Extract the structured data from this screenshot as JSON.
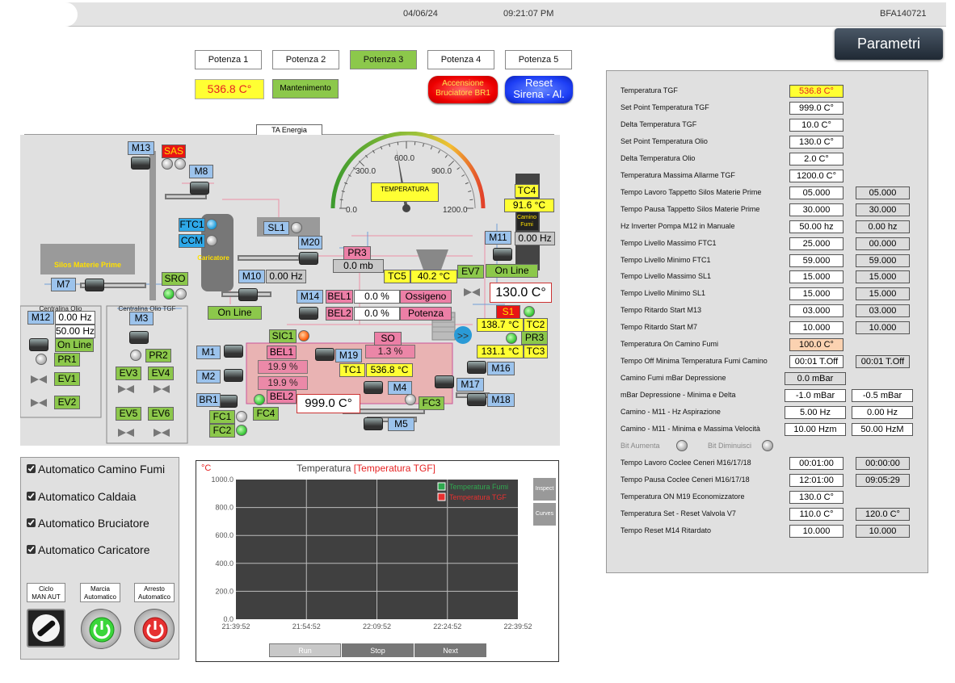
{
  "header": {
    "date": "04/06/24",
    "time": "09:21:07 PM",
    "device": "BFA140721"
  },
  "parametri_label": "Parametri",
  "potenza": [
    "Potenza 1",
    "Potenza 2",
    "Potenza 3",
    "Potenza 4",
    "Potenza 5"
  ],
  "potenza_active": 2,
  "temp_main": "536.8 C°",
  "mantenimento": "Mantenimento",
  "accensione": {
    "line1": "Accensione",
    "line2": "Bruciatore BR1"
  },
  "reset": {
    "line1": "Reset",
    "line2": "Sirena - Al."
  },
  "plant": {
    "ta_energia": "TA Energia",
    "gauge": {
      "t0": "0.0",
      "t300": "300.0",
      "t600": "600.0",
      "t900": "900.0",
      "t1200": "1200.0",
      "label": "TEMPERATURA",
      "value_fraction": 0.447
    },
    "silos": "Silos Materie Prime",
    "caricatore": "Caricatore",
    "camino": {
      "line1": "Camino",
      "line2": "Fumi"
    },
    "centralina_olio": "Centralina Olio",
    "centralina_olio_tgf": "Centralina Olio TGF",
    "labels": {
      "m13": "M13",
      "sas": "SAS",
      "m8": "M8",
      "ftc1": "FTC1",
      "ccm": "CCM",
      "sl1": "SL1",
      "m20": "M20",
      "pr3": "PR3",
      "pr3_val": "0.0 mb",
      "tc4": "TC4",
      "tc4_val": "91.6 °C",
      "m11": "M11",
      "m11_val": "0.00 Hz",
      "on_line_a": "On Line",
      "ev7": "EV7",
      "tc5": "TC5",
      "tc5_val": "40.2 °C",
      "m7": "M7",
      "sro": "SRO",
      "m10": "M10",
      "m10_val": "0.00 Hz",
      "on_line_b": "On Line",
      "m14": "M14",
      "bel1": "BEL1",
      "bel1_val": "0.0 %",
      "ossigeno": "Ossigeno",
      "bel2": "BEL2",
      "bel2_val": "0.0 %",
      "potenza": "Potenza",
      "big_temp": "130.0 C°",
      "s1": "S1",
      "tc2_val": "138.7 °C",
      "tc2": "TC2",
      "pr3b": "PR3",
      "tc3_val": "131.1 °C",
      "tc3": "TC3",
      "m12": "M12",
      "m12_val": "0.00 Hz",
      "m12_set": "50.00 Hz",
      "on_line_c": "On Line",
      "pr1": "PR1",
      "m3": "M3",
      "pr2": "PR2",
      "ev1": "EV1",
      "ev3": "EV3",
      "ev4": "EV4",
      "ev2": "EV2",
      "ev5": "EV5",
      "ev6": "EV6",
      "sic1": "SIC1",
      "so": "SO",
      "so_val": "1.3 %",
      "m1": "M1",
      "bel1b": "BEL1",
      "m19": "M19",
      "pct1": "19.9 %",
      "pct2": "19.9 %",
      "tc1": "TC1",
      "tc1_val": "536.8 °C",
      "m16": "M16",
      "m2": "M2",
      "m17": "M17",
      "m4": "M4",
      "br1": "BR1",
      "bel2b": "BEL2",
      "set_temp": "999.0 C°",
      "fc3": "FC3",
      "m18": "M18",
      "fc1": "FC1",
      "fc4": "FC4",
      "m5": "M5",
      "fc2": "FC2"
    }
  },
  "parametri": [
    {
      "label": "Temperatura TGF",
      "v1": "536.8 C°",
      "style1": "y"
    },
    {
      "label": "Set Point Temperatura TGF",
      "v1": "999.0 C°"
    },
    {
      "label": "Delta Temperatura TGF",
      "v1": "10.0 C°"
    },
    {
      "label": "Set Point Temperatura Olio",
      "v1": "130.0 C°"
    },
    {
      "label": "Delta Temperatura Olio",
      "v1": "2.0 C°"
    },
    {
      "label": "Temperatura Massima Allarme TGF",
      "v1": "1200.0 C°"
    },
    {
      "label": "Tempo Lavoro Tappetto Silos Materie Prime",
      "v1": "05.000",
      "v2": "05.000"
    },
    {
      "label": "Tempo Pausa Tappetto Silos Materie Prime",
      "v1": "30.000",
      "v2": "30.000"
    },
    {
      "label": "Hz Inverter Pompa M12 in Manuale",
      "v1": "50.00 hz",
      "v2": "0.00 hz"
    },
    {
      "label": "Tempo Livello Massimo FTC1",
      "v1": "25.000",
      "v2": "00.000"
    },
    {
      "label": "Tempo Livello Minimo FTC1",
      "v1": "59.000",
      "v2": "59.000"
    },
    {
      "label": "Tempo Livello Massimo SL1",
      "v1": "15.000",
      "v2": "15.000"
    },
    {
      "label": "Tempo Livello Minimo SL1",
      "v1": "15.000",
      "v2": "15.000"
    },
    {
      "label": "Tempo Ritardo Start M13",
      "v1": "03.000",
      "v2": "03.000"
    },
    {
      "label": "Tempo Ritardo Start M7",
      "v1": "10.000",
      "v2": "10.000"
    },
    {
      "label": "Temperatura On Camino Fumi",
      "v1": "100.0 C°",
      "style1": "o"
    },
    {
      "label": "Tempo Off Minima Temperatura Fumi Camino",
      "v1": "00:01 T.Off",
      "v2": "00:01 T.Off"
    },
    {
      "label": "Camino Fumi mBar Depressione",
      "v1": "0.0 mBar",
      "style1": "g",
      "x1": 220
    },
    {
      "label": "mBar Depressione - Minima e Delta",
      "v1": "-1.0 mBar",
      "v2": "-0.5 mBar",
      "x1": 220,
      "x2": 303
    },
    {
      "label": "Camino - M11 - Hz Aspirazione",
      "v1": "5.00 Hz",
      "v2": "0.00 Hz",
      "x1": 220,
      "x2": 303
    },
    {
      "label": "Camino - M11 - Minima e Massima Velocità",
      "v1": "10.00 Hzm",
      "v2": "50.00 HzM",
      "x1": 220,
      "x2": 303
    }
  ],
  "bits": {
    "aumenta": "Bit Aumenta",
    "diminuisci": "Bit Diminuisci"
  },
  "parametri2": [
    {
      "label": "Tempo Lavoro Coclee Ceneri M16/17/18",
      "v1": "00:01:00",
      "v2": "00:00:00"
    },
    {
      "label": "Tempo Pausa Coclee Ceneri M16/17/18",
      "v1": "12:01:00",
      "v2": "09:05:29"
    },
    {
      "label": "Temperatura ON M19 Economizzatore",
      "v1": "130.0 C°"
    },
    {
      "label": "Temperatura Set - Reset Valvola V7",
      "v1": "110.0 C°",
      "v2": "120.0 C°"
    },
    {
      "label": "Tempo Reset M14 Ritardato",
      "v1": "10.000",
      "v2": "10.000"
    }
  ],
  "checkboxes": [
    "Automatico Camino Fumi",
    "Automatico Caldaia",
    "Automatico Bruciatore",
    "Automatico Caricatore"
  ],
  "modes": {
    "ciclo": "Ciclo",
    "man_aut": "MAN  AUT",
    "marcia": "Marcia",
    "marcia2": "Automatico",
    "arresto": "Arresto",
    "arresto2": "Automatico"
  },
  "chart_data": {
    "type": "line",
    "title": "Temperatura",
    "title_highlight": "[Temperatura TGF]",
    "ylabel": "°C",
    "ylim": [
      0,
      1000
    ],
    "yticks": [
      "1000.0",
      "800.0",
      "600.0",
      "400.0",
      "200.0",
      "0.0"
    ],
    "x": [
      "21:39:52",
      "21:54:52",
      "22:09:52",
      "22:24:52",
      "22:39:52"
    ],
    "series": [
      {
        "name": "Temperatura Fumi",
        "color": "#2fa84f",
        "values": []
      },
      {
        "name": "Temperatura TGF",
        "color": "#e83030",
        "values": []
      }
    ],
    "grid": true,
    "legend": "top-right"
  },
  "chart_controls": {
    "inspect": "Inspect",
    "curves": "Curves",
    "run": "Run",
    "stop": "Stop",
    "next": "Next"
  }
}
